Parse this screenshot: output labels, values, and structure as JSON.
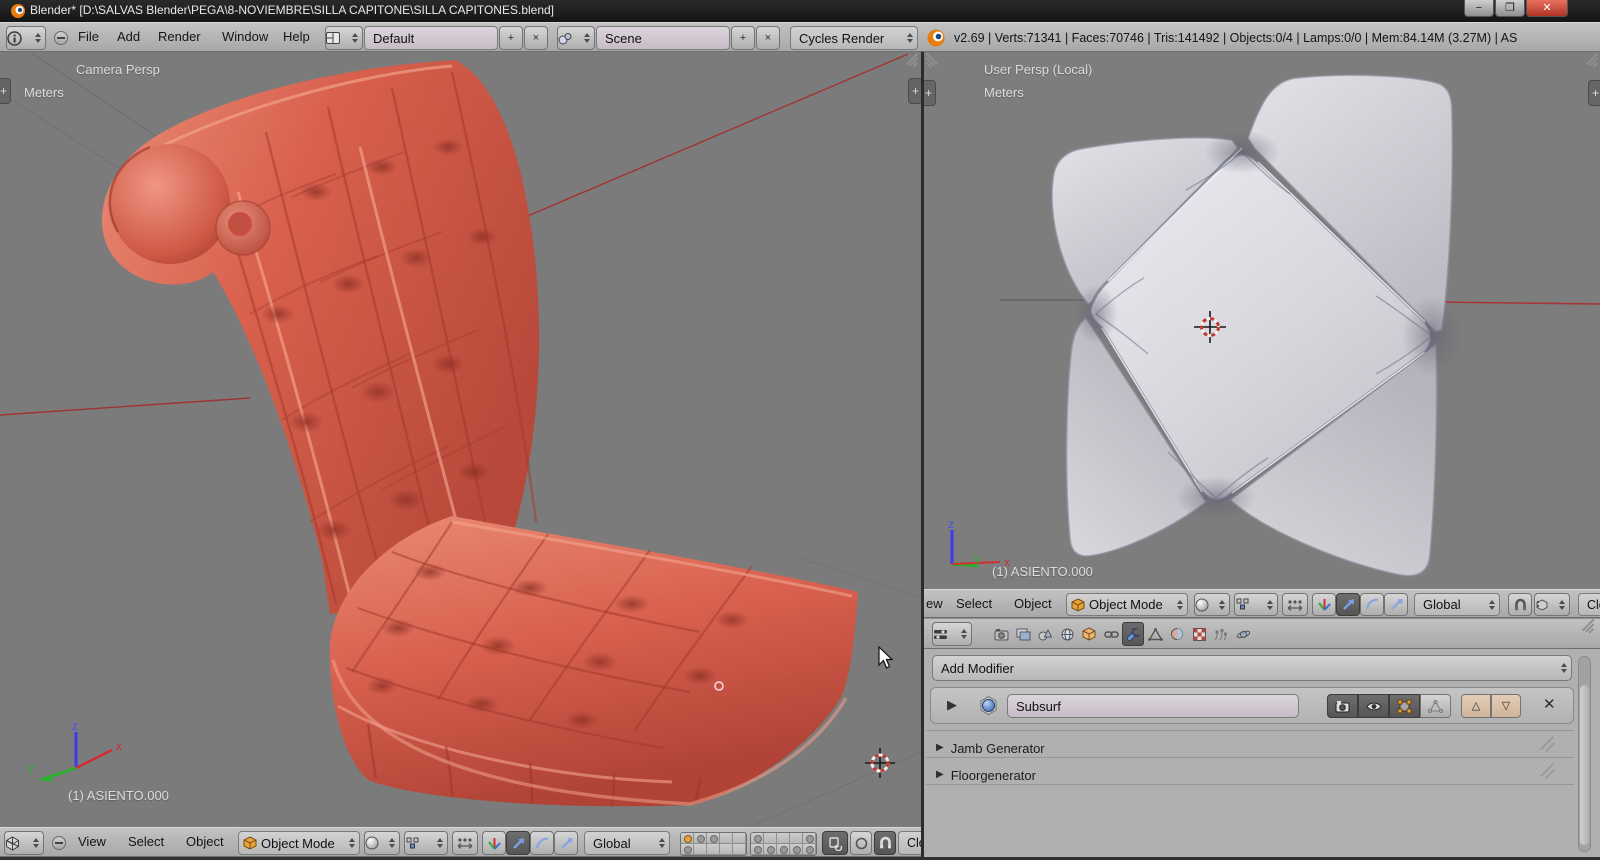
{
  "window": {
    "title": "Blender* [D:\\SALVAS Blender\\PEGA\\8-NOVIEMBRE\\SILLA CAPITONE\\SILLA CAPITONES.blend]",
    "controls": {
      "minimize": "−",
      "restore": "❐",
      "close": "✕"
    }
  },
  "info_header": {
    "menus": {
      "file": "File",
      "add": "Add",
      "render": "Render",
      "window": "Window",
      "help": "Help"
    },
    "screen_layout": {
      "value": "Default"
    },
    "scene": {
      "value": "Scene"
    },
    "engine": {
      "value": "Cycles Render"
    },
    "stats": "v2.69 | Verts:71341 | Faces:70746 | Tris:141492 | Objects:0/4 | Lamps:0/0 | Mem:84.14M (3.27M) | AS"
  },
  "viewports": {
    "left": {
      "view_label": "Camera Persp",
      "unit_label": "Meters",
      "object_name": "(1) ASIENTO.000"
    },
    "right": {
      "view_label": "User Persp (Local)",
      "unit_label": "Meters",
      "object_name": "(1) ASIENTO.000"
    },
    "axis": {
      "x": "x",
      "y": "y",
      "z": "z"
    }
  },
  "view_header": {
    "menus": {
      "view": "View",
      "select": "Select",
      "object": "Object"
    },
    "view_partial": "ew",
    "mode": "Object Mode",
    "orientation": "Global",
    "partial_left": "Clos",
    "partial_right": "Clo"
  },
  "properties": {
    "add_modifier": "Add Modifier",
    "modifier": {
      "name": "Subsurf"
    },
    "panels": {
      "jamb": "Jamb Generator",
      "floor": "Floorgenerator"
    }
  },
  "layers": {
    "group1": [
      [
        "on",
        "dot",
        "dot",
        "off",
        "off"
      ],
      [
        "dot",
        "off",
        "off",
        "off",
        "off"
      ]
    ],
    "group2": [
      [
        "dot",
        "off",
        "off",
        "off",
        "dot"
      ],
      [
        "dot",
        "dot",
        "dot",
        "dot",
        "dot"
      ]
    ]
  },
  "icons": {
    "plus": "+",
    "close_x": "×",
    "minus": "−",
    "expand": "▶",
    "up": "△",
    "down": "▽",
    "delete": "✕"
  },
  "colors": {
    "header_gray": "#b4b4b4",
    "viewport_gray": "#7b7b7b",
    "chair_red": "#d05a4a",
    "field_lavender": "#d8cfd8",
    "beige_button": "#ddc3ac",
    "active_blue": "#5a82c8",
    "layer_orange": "#e8a33d",
    "close_red": "#d9503f",
    "axis_x": "#bb3333",
    "axis_y": "#33aa33",
    "axis_z": "#3333bb"
  }
}
